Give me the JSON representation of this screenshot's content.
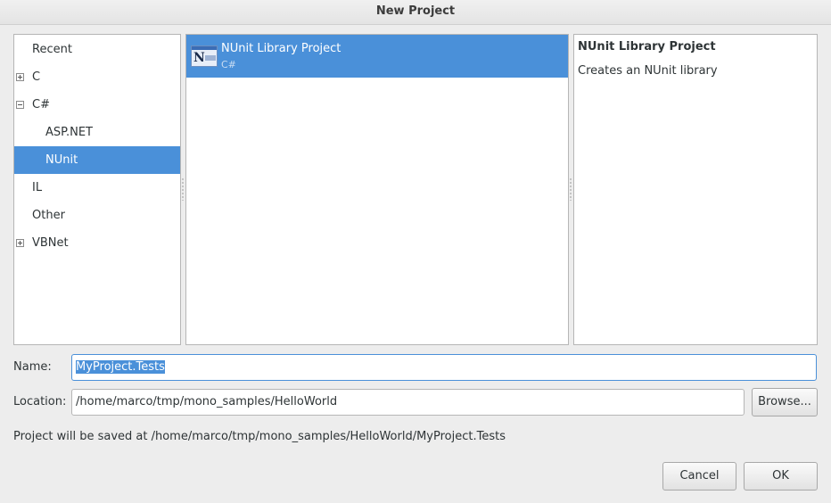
{
  "window": {
    "title": "New Project"
  },
  "categories": [
    {
      "label": "Recent",
      "expander": "none",
      "indent": 0,
      "selected": false
    },
    {
      "label": "C",
      "expander": "plus",
      "indent": 0,
      "selected": false
    },
    {
      "label": "C#",
      "expander": "minus",
      "indent": 0,
      "selected": false
    },
    {
      "label": "ASP.NET",
      "expander": "none",
      "indent": 1,
      "selected": false
    },
    {
      "label": "NUnit",
      "expander": "none",
      "indent": 1,
      "selected": true
    },
    {
      "label": "IL",
      "expander": "none",
      "indent": 0,
      "selected": false
    },
    {
      "label": "Other",
      "expander": "none",
      "indent": 0,
      "selected": false
    },
    {
      "label": "VBNet",
      "expander": "plus",
      "indent": 0,
      "selected": false
    }
  ],
  "templates": [
    {
      "name": "NUnit Library Project",
      "language": "C#",
      "icon": "nunit-project-icon",
      "selected": true
    }
  ],
  "description": {
    "title": "NUnit Library Project",
    "text": "Creates an NUnit library"
  },
  "form": {
    "name_label": "Name:",
    "name_value": "MyProject.Tests",
    "location_label": "Location:",
    "location_value": "/home/marco/tmp/mono_samples/HelloWorld",
    "browse_label": "Browse...",
    "info_text": "Project will be saved at /home/marco/tmp/mono_samples/HelloWorld/MyProject.Tests"
  },
  "buttons": {
    "cancel": "Cancel",
    "ok": "OK"
  },
  "colors": {
    "selection": "#4a90d9",
    "background": "#ededed"
  }
}
